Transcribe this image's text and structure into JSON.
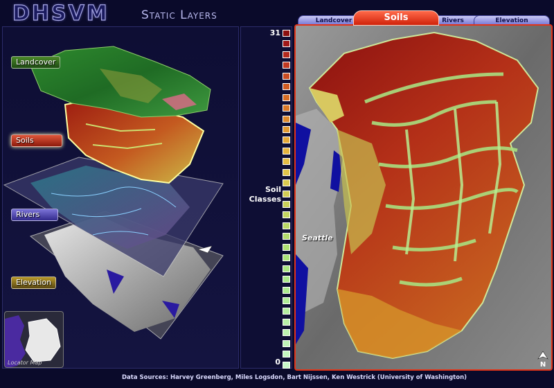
{
  "header": {
    "title": "DHSVM",
    "subtitle": "Static Layers"
  },
  "tabs": [
    {
      "label": "Landcover",
      "active": false
    },
    {
      "label": "Soils",
      "active": true
    },
    {
      "label": "Rivers",
      "active": false
    },
    {
      "label": "Elevation",
      "active": false
    }
  ],
  "layers": {
    "landcover": "Landcover",
    "soils": "Soils",
    "rivers": "Rivers",
    "elevation": "Elevation"
  },
  "locator": {
    "label": "Locator Map"
  },
  "legend": {
    "title": "Soil Classes",
    "max": "31",
    "min": "0",
    "colors": [
      "#8b0f0f",
      "#a01818",
      "#b42a1e",
      "#c03a22",
      "#c94c22",
      "#d05c22",
      "#d66c24",
      "#db7a28",
      "#df8a2c",
      "#e29a32",
      "#e4a838",
      "#e5b43e",
      "#e4bd44",
      "#e0c44a",
      "#dac94e",
      "#d2cd54",
      "#cad15a",
      "#c2d560",
      "#bad966",
      "#b3dc6c",
      "#aee072",
      "#aae378",
      "#a8e680",
      "#a9e888",
      "#acea90",
      "#b0ec98",
      "#b4eea0",
      "#b8f0a8",
      "#bcf2b0",
      "#c0f4b8",
      "#c4f6c0",
      "#c8f8c8"
    ]
  },
  "map": {
    "city_label": "Seattle",
    "north_label": "N"
  },
  "colors": {
    "soil_dark": "#8b0f0f",
    "soil_mid": "#c86420",
    "soil_light": "#aee072",
    "water": "#1010a0",
    "active_tab": "#e23418",
    "inactive_tab": "#9a9ae6"
  },
  "footer": {
    "credits": "Data Sources: Harvey Greenberg, Miles Logsdon, Bart Nijssen, Ken Westrick (University of Washington)"
  }
}
